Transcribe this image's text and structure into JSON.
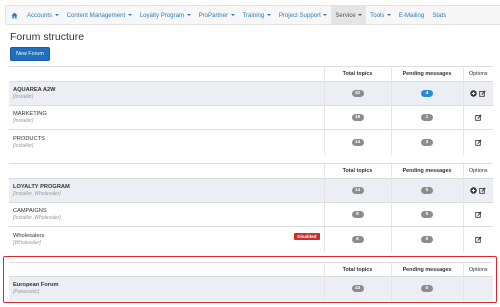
{
  "nav": {
    "home_icon": "home-icon",
    "items": [
      {
        "label": "Accounts",
        "dropdown": true
      },
      {
        "label": "Content Management",
        "dropdown": true
      },
      {
        "label": "Loyalty Program",
        "dropdown": true
      },
      {
        "label": "ProPartner",
        "dropdown": true
      },
      {
        "label": "Training",
        "dropdown": true
      },
      {
        "label": "Project Support",
        "dropdown": true
      },
      {
        "label": "Service",
        "dropdown": true,
        "active": true
      },
      {
        "label": "Tools",
        "dropdown": true
      },
      {
        "label": "E-Mailing",
        "dropdown": false
      },
      {
        "label": "Stats",
        "dropdown": false
      }
    ]
  },
  "page": {
    "title": "Forum structure",
    "new_button": "New Forum"
  },
  "headers": {
    "total_topics": "Total topics",
    "pending_messages": "Pending messages",
    "options": "Options"
  },
  "colors": {
    "nav_link": "#2f7bc2",
    "primary_button": "#1e6fbd",
    "badge_gray": "#8c8c8c",
    "badge_blue": "#2a8ccf",
    "disabled_label": "#c9302c",
    "highlight_border": "#d62a2a",
    "parent_row_bg": "#ebeff3"
  },
  "tables": [
    {
      "rows": [
        {
          "name": "AQUAREA A2W",
          "sub": "[Installer]",
          "total": "32",
          "pending": "4",
          "pending_highlight": true,
          "parent": true,
          "options": [
            "add-icon",
            "edit-icon"
          ]
        },
        {
          "name": "MARKETING",
          "sub": "[Installer]",
          "total": "18",
          "pending": "1",
          "parent": false,
          "options": [
            "edit-icon"
          ]
        },
        {
          "name": "PRODUCTS",
          "sub": "[Installer]",
          "total": "14",
          "pending": "3",
          "parent": false,
          "options": [
            "edit-icon"
          ]
        }
      ]
    },
    {
      "rows": [
        {
          "name": "LOYALTY PROGRAM",
          "sub": "[Installer, Wholesaler]",
          "total": "14",
          "pending": "0",
          "parent": true,
          "options": [
            "add-icon",
            "edit-icon"
          ]
        },
        {
          "name": "CAMPAIGNS",
          "sub": "[Installer, Wholesaler]",
          "total": "8",
          "pending": "0",
          "parent": false,
          "options": [
            "edit-icon"
          ]
        },
        {
          "name": "Wholesalers",
          "sub": "[Wholesaler]",
          "status": "Disabled",
          "total": "6",
          "pending": "0",
          "parent": false,
          "options": [
            "edit-icon"
          ]
        }
      ]
    },
    {
      "rows": [
        {
          "name": "European Forum",
          "sub": "[Panasonic]",
          "total": "43",
          "pending": "0",
          "parent": true,
          "options": []
        }
      ]
    }
  ]
}
